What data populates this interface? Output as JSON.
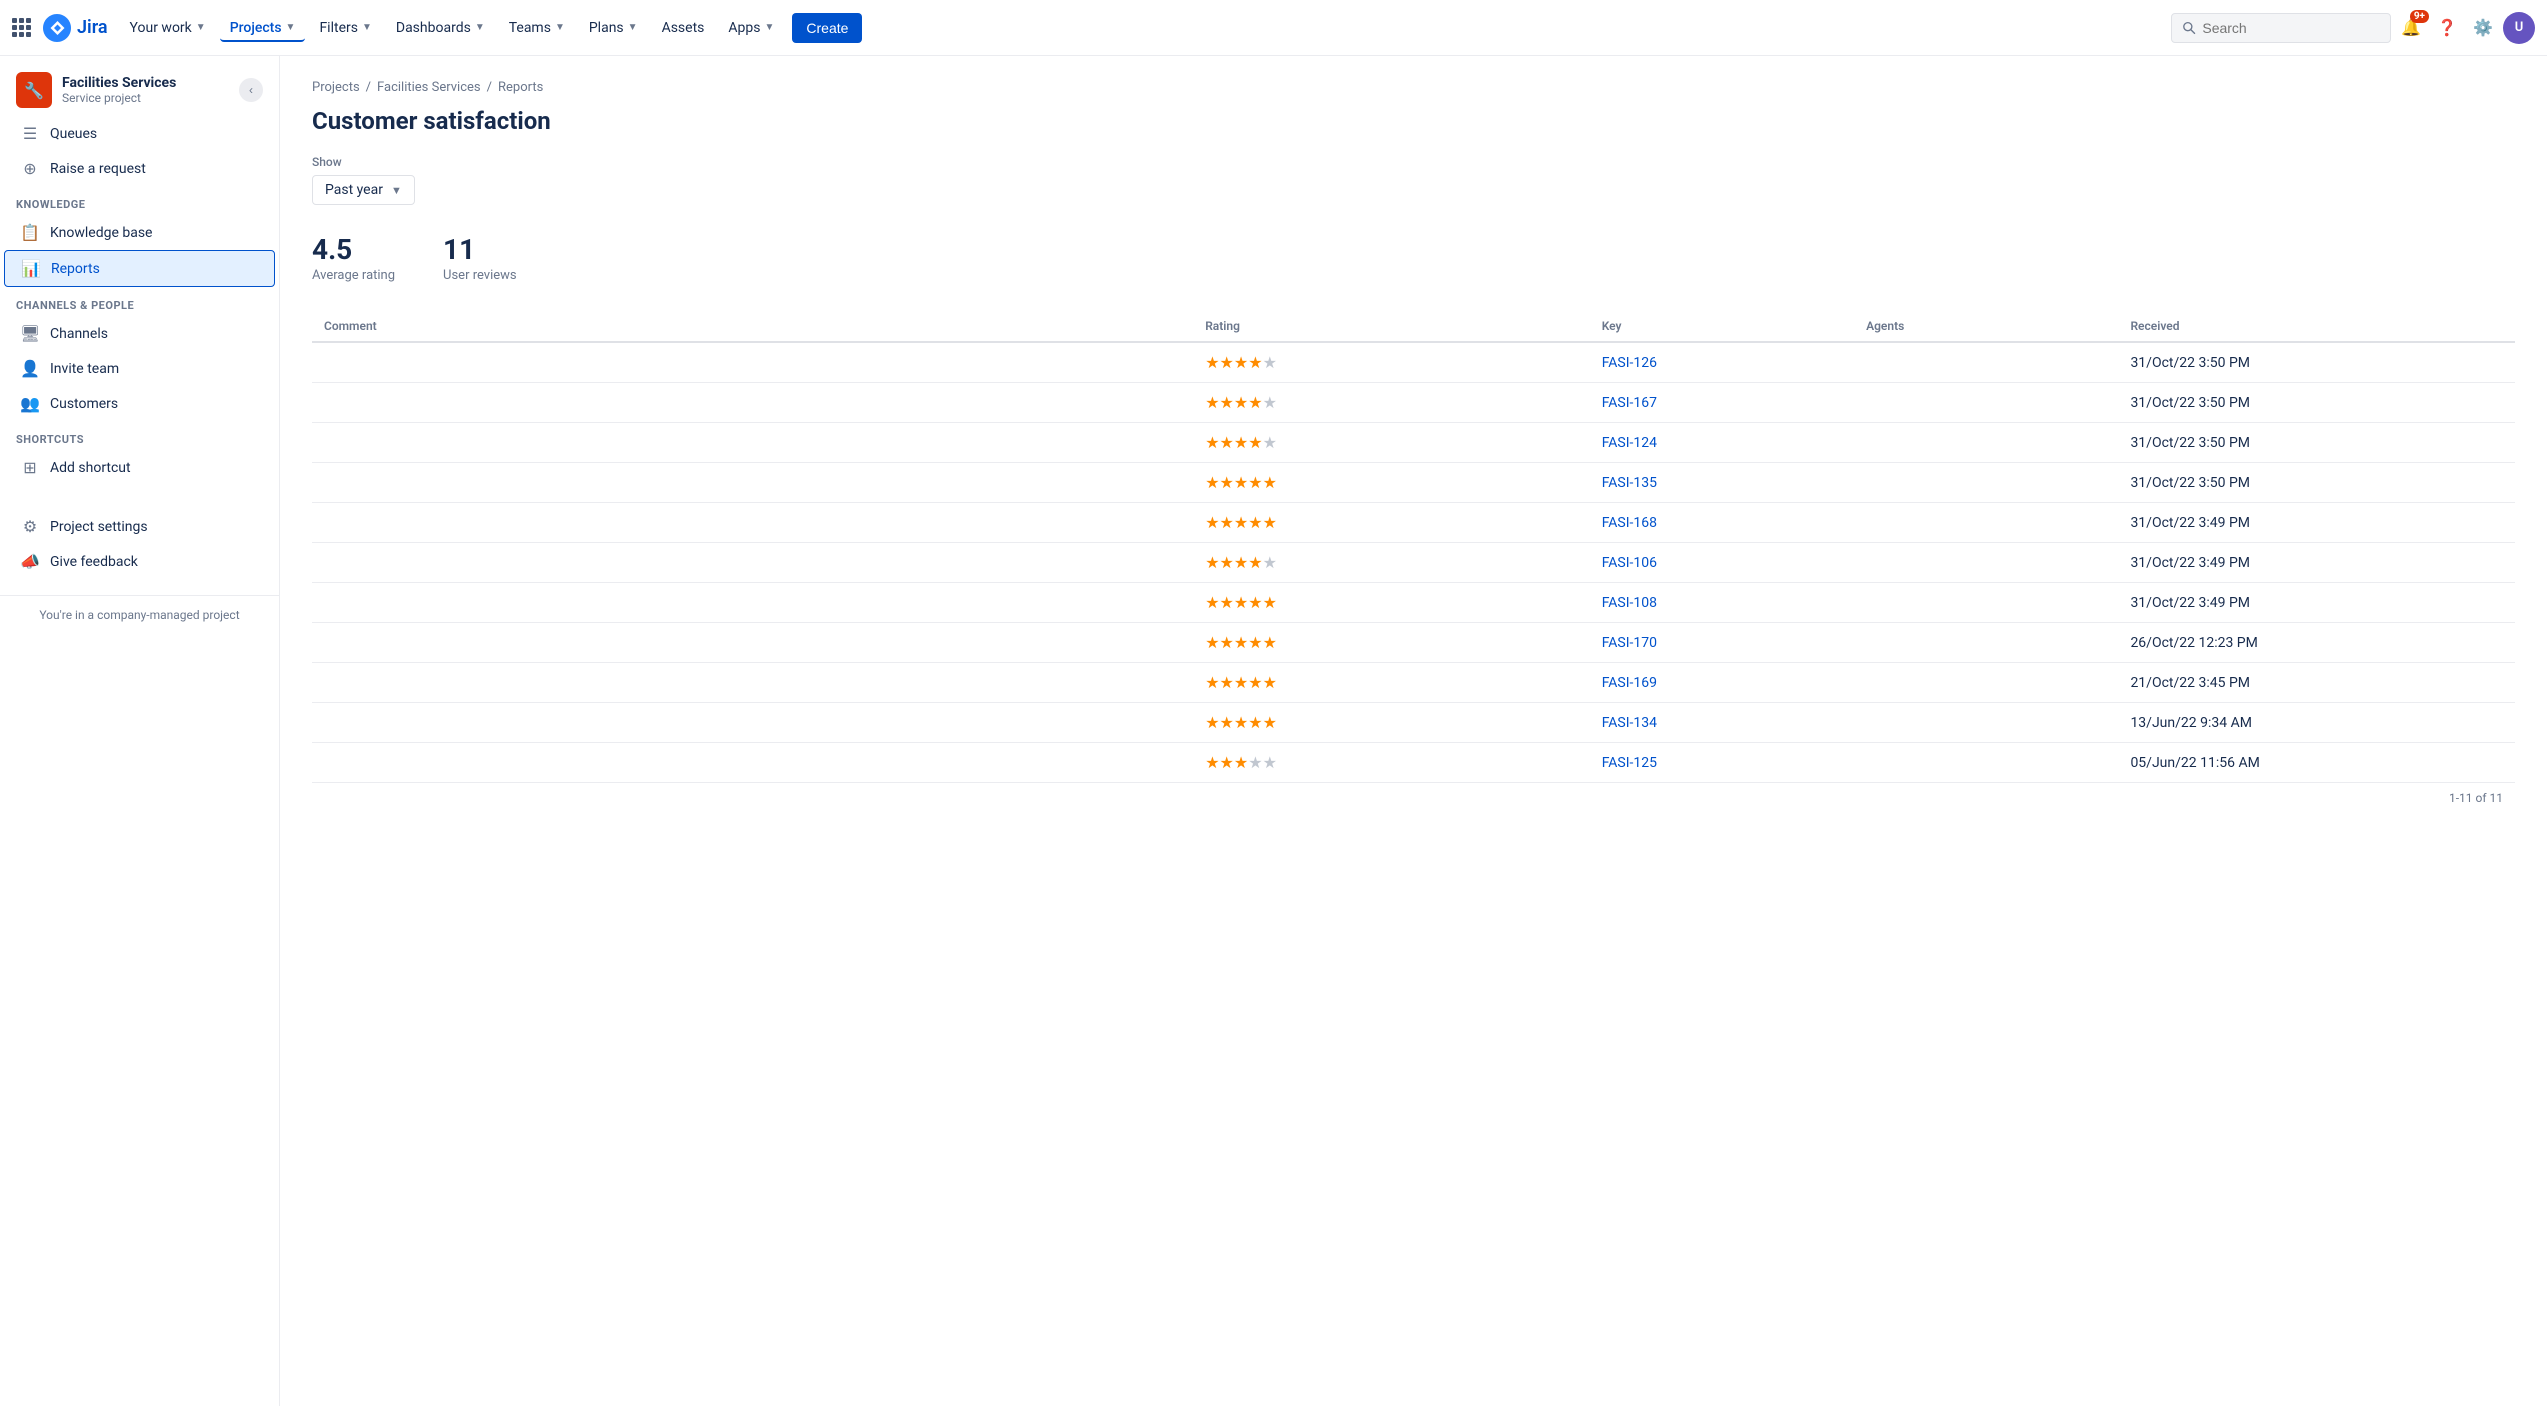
{
  "nav": {
    "logo_text": "Jira",
    "items": [
      {
        "label": "Your work",
        "has_chevron": true,
        "active": false
      },
      {
        "label": "Projects",
        "has_chevron": true,
        "active": true
      },
      {
        "label": "Filters",
        "has_chevron": true,
        "active": false
      },
      {
        "label": "Dashboards",
        "has_chevron": true,
        "active": false
      },
      {
        "label": "Teams",
        "has_chevron": true,
        "active": false
      },
      {
        "label": "Plans",
        "has_chevron": true,
        "active": false
      },
      {
        "label": "Assets",
        "has_chevron": false,
        "active": false
      },
      {
        "label": "Apps",
        "has_chevron": true,
        "active": false
      }
    ],
    "create_label": "Create",
    "search_placeholder": "Search",
    "notification_badge": "9+",
    "avatar_initials": "U"
  },
  "sidebar": {
    "project_name": "Facilities Services",
    "project_type": "Service project",
    "nav_items": [
      {
        "label": "Queues",
        "icon": "☰",
        "active": false
      },
      {
        "label": "Raise a request",
        "icon": "⊕",
        "active": false
      }
    ],
    "knowledge_section": "KNOWLEDGE",
    "knowledge_items": [
      {
        "label": "Knowledge base",
        "icon": "📋",
        "active": false
      },
      {
        "label": "Reports",
        "icon": "📊",
        "active": true
      }
    ],
    "channels_section": "CHANNELS & PEOPLE",
    "channels_items": [
      {
        "label": "Channels",
        "icon": "🖥",
        "active": false
      },
      {
        "label": "Invite team",
        "icon": "👤",
        "active": false
      },
      {
        "label": "Customers",
        "icon": "👥",
        "active": false
      }
    ],
    "shortcuts_section": "SHORTCUTS",
    "shortcuts_items": [
      {
        "label": "Add shortcut",
        "icon": "⊞",
        "active": false
      }
    ],
    "bottom_items": [
      {
        "label": "Project settings",
        "icon": "⚙"
      },
      {
        "label": "Give feedback",
        "icon": "📣"
      }
    ],
    "footer_text": "You're in a company-managed project"
  },
  "breadcrumb": {
    "items": [
      "Projects",
      "Facilities Services",
      "Reports"
    ]
  },
  "page": {
    "title": "Customer satisfaction",
    "show_label": "Show",
    "filter_value": "Past year",
    "stats": {
      "average_rating": "4.5",
      "average_label": "Average rating",
      "user_reviews": "11",
      "reviews_label": "User reviews"
    },
    "table": {
      "columns": [
        "Comment",
        "Rating",
        "Key",
        "Agents",
        "Received"
      ],
      "rows": [
        {
          "comment": "",
          "rating": 4,
          "key": "FASI-126",
          "agents": "",
          "received": "31/Oct/22 3:50 PM"
        },
        {
          "comment": "",
          "rating": 4,
          "key": "FASI-167",
          "agents": "",
          "received": "31/Oct/22 3:50 PM"
        },
        {
          "comment": "",
          "rating": 4,
          "key": "FASI-124",
          "agents": "",
          "received": "31/Oct/22 3:50 PM"
        },
        {
          "comment": "",
          "rating": 5,
          "key": "FASI-135",
          "agents": "",
          "received": "31/Oct/22 3:50 PM"
        },
        {
          "comment": "",
          "rating": 5,
          "key": "FASI-168",
          "agents": "",
          "received": "31/Oct/22 3:49 PM"
        },
        {
          "comment": "",
          "rating": 4,
          "key": "FASI-106",
          "agents": "",
          "received": "31/Oct/22 3:49 PM"
        },
        {
          "comment": "",
          "rating": 5,
          "key": "FASI-108",
          "agents": "",
          "received": "31/Oct/22 3:49 PM"
        },
        {
          "comment": "",
          "rating": 5,
          "key": "FASI-170",
          "agents": "",
          "received": "26/Oct/22 12:23 PM"
        },
        {
          "comment": "",
          "rating": 5,
          "key": "FASI-169",
          "agents": "",
          "received": "21/Oct/22 3:45 PM"
        },
        {
          "comment": "",
          "rating": 5,
          "key": "FASI-134",
          "agents": "",
          "received": "13/Jun/22 9:34 AM"
        },
        {
          "comment": "",
          "rating": 3,
          "key": "FASI-125",
          "agents": "",
          "received": "05/Jun/22 11:56 AM"
        }
      ],
      "pagination": "1-11 of 11"
    }
  }
}
